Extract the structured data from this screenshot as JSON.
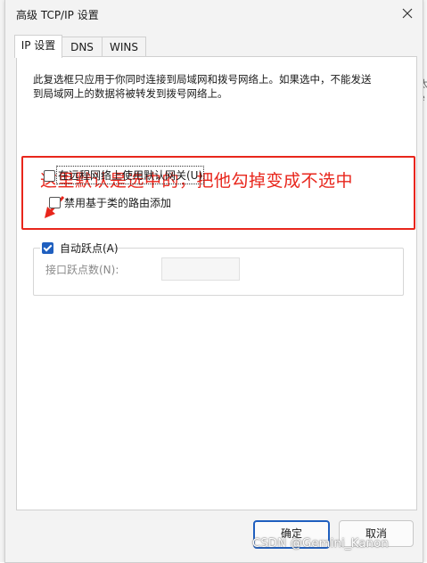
{
  "window": {
    "title": "高级 TCP/IP 设置",
    "close_icon": "close-icon"
  },
  "background": {
    "chars": [
      "太",
      "e",
      "t"
    ]
  },
  "tabs": [
    {
      "label": "IP 设置",
      "active": true
    },
    {
      "label": "DNS",
      "active": false
    },
    {
      "label": "WINS",
      "active": false
    }
  ],
  "panel": {
    "description": "此复选框只应用于你同时连接到局域网和拨号网络上。如果选中，不能发送到局域网上的数据将被转发到拨号网络上。",
    "annotation": "这里默认是选中的，把他勾掉变成不选中",
    "annotation_color": "#e8261c",
    "use_default_gateway": {
      "label": "在远程网络上使用默认网关(U)",
      "checked": false
    },
    "disable_class_routes": {
      "label": "禁用基于类的路由添加",
      "checked": false
    },
    "auto_metric": {
      "label": "自动跃点(A)",
      "checked": true
    },
    "interface_metric": {
      "label": "接口跃点数(N):",
      "value": ""
    }
  },
  "buttons": {
    "ok": "确定",
    "cancel": "取消"
  },
  "watermark": "CSDN @Gemini_Kanon",
  "colors": {
    "accent": "#1f5fbf",
    "dialog_bg": "#f3f3f3"
  }
}
